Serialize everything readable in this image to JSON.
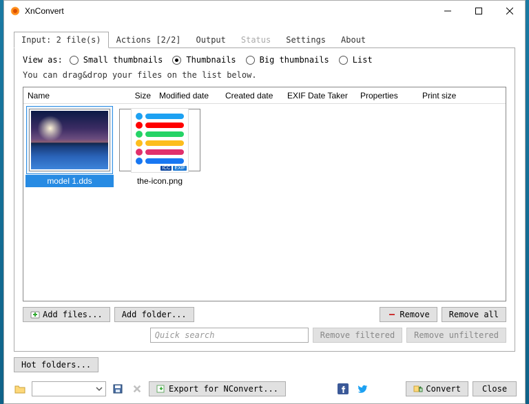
{
  "window": {
    "title": "XnConvert"
  },
  "tabs": {
    "input": "Input: 2 file(s)",
    "actions": "Actions [2/2]",
    "output": "Output",
    "status": "Status",
    "settings": "Settings",
    "about": "About",
    "active": "input",
    "disabled": [
      "status"
    ]
  },
  "view": {
    "label": "View as:",
    "options": {
      "small": "Small thumbnails",
      "thumbs": "Thumbnails",
      "big": "Big thumbnails",
      "list": "List"
    },
    "selected": "thumbs",
    "hint": "You can drag&drop your files on the list below."
  },
  "columns": {
    "name": "Name",
    "size": "Size",
    "modified": "Modified date",
    "created": "Created date",
    "exif": "EXIF Date Taker",
    "properties": "Properties",
    "print": "Print size"
  },
  "files": [
    {
      "name": "model 1.dds",
      "selected": true,
      "kind": "landscape"
    },
    {
      "name": "the-icon.png",
      "selected": false,
      "kind": "social-sheet"
    }
  ],
  "social_rows": [
    {
      "color": "#1da1f2"
    },
    {
      "color": "#ff0000"
    },
    {
      "color": "#25d366"
    },
    {
      "color": "#fdbd1d"
    },
    {
      "color": "#e1306c"
    },
    {
      "color": "#1877f2"
    }
  ],
  "badges": {
    "icc": "ICC",
    "exif": "EXIF",
    "icc_bg": "#0d47a1",
    "exif_bg": "#1976d2"
  },
  "buttons": {
    "add_files": "Add files...",
    "add_folder": "Add folder...",
    "remove": "Remove",
    "remove_all": "Remove all",
    "hot_folders": "Hot folders...",
    "remove_filtered": "Remove filtered",
    "remove_unfiltered": "Remove unfiltered",
    "export": "Export for NConvert...",
    "convert": "Convert",
    "close": "Close"
  },
  "search": {
    "placeholder": "Quick search"
  },
  "colors": {
    "accent": "#278be3"
  }
}
